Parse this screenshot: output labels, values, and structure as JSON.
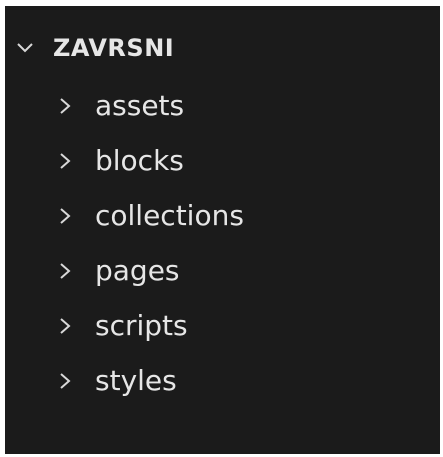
{
  "explorer": {
    "root": {
      "label": "ZAVRSNI",
      "icon": "chevron-down-icon",
      "expanded": true
    },
    "folders": [
      {
        "label": "assets",
        "icon": "chevron-right-icon",
        "expanded": false
      },
      {
        "label": "blocks",
        "icon": "chevron-right-icon",
        "expanded": false
      },
      {
        "label": "collections",
        "icon": "chevron-right-icon",
        "expanded": false
      },
      {
        "label": "pages",
        "icon": "chevron-right-icon",
        "expanded": false
      },
      {
        "label": "scripts",
        "icon": "chevron-right-icon",
        "expanded": false
      },
      {
        "label": "styles",
        "icon": "chevron-right-icon",
        "expanded": false
      }
    ]
  },
  "colors": {
    "background": "#1b1b1b",
    "text": "#e6e6e6",
    "frame": "#ffffff"
  }
}
